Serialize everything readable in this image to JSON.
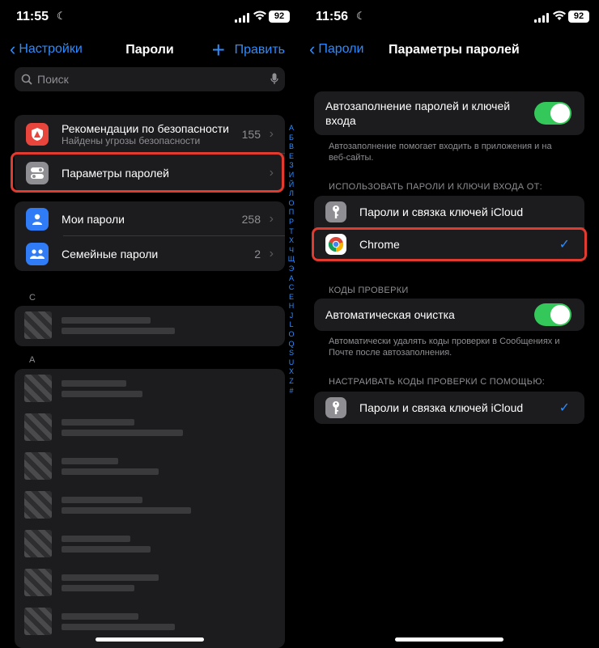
{
  "left": {
    "status": {
      "time": "11:55",
      "battery": "92"
    },
    "nav": {
      "back": "Настройки",
      "title": "Пароли",
      "edit": "Править"
    },
    "search": {
      "placeholder": "Поиск"
    },
    "security": {
      "title": "Рекомендации по безопасности",
      "subtitle": "Найдены угрозы безопасности",
      "count": "155"
    },
    "settings": {
      "label": "Параметры паролей"
    },
    "my_passwords": {
      "label": "Мои пароли",
      "count": "258"
    },
    "family_passwords": {
      "label": "Семейные пароли",
      "count": "2"
    },
    "section_c": "C",
    "section_a": "A",
    "index": [
      "A",
      "Б",
      "В",
      "Е",
      "З",
      "И",
      "Й",
      "Л",
      "О",
      "П",
      "Р",
      "Т",
      "Х",
      "Ч",
      "Щ",
      "Э",
      "А",
      "С",
      "Е",
      "Н",
      "J",
      "L",
      "O",
      "Q",
      "S",
      "U",
      "X",
      "Z",
      "#"
    ]
  },
  "right": {
    "status": {
      "time": "11:56",
      "battery": "92"
    },
    "nav": {
      "back": "Пароли",
      "title": "Параметры паролей"
    },
    "autofill": {
      "label": "Автозаполнение паролей и ключей входа",
      "enabled": true
    },
    "autofill_footer": "Автозаполнение помогает входить в приложения и на веб-сайты.",
    "use_from_header": "ИСПОЛЬЗОВАТЬ ПАРОЛИ И КЛЮЧИ ВХОДА ОТ:",
    "providers": [
      {
        "label": "Пароли и связка ключей iCloud",
        "checked": false
      },
      {
        "label": "Chrome",
        "checked": true
      }
    ],
    "codes_header": "КОДЫ ПРОВЕРКИ",
    "auto_clean": {
      "label": "Автоматическая очистка",
      "enabled": true
    },
    "auto_clean_footer": "Автоматически удалять коды проверки в Сообщениях и Почте после автозаполнения.",
    "codes_with_header": "НАСТРАИВАТЬ КОДЫ ПРОВЕРКИ С ПОМОЩЬЮ:",
    "codes_provider": {
      "label": "Пароли и связка ключей iCloud",
      "checked": true
    }
  },
  "colors": {
    "accent": "#2c8cff",
    "highlight": "#e13a2f",
    "toggle_on": "#34c759"
  }
}
